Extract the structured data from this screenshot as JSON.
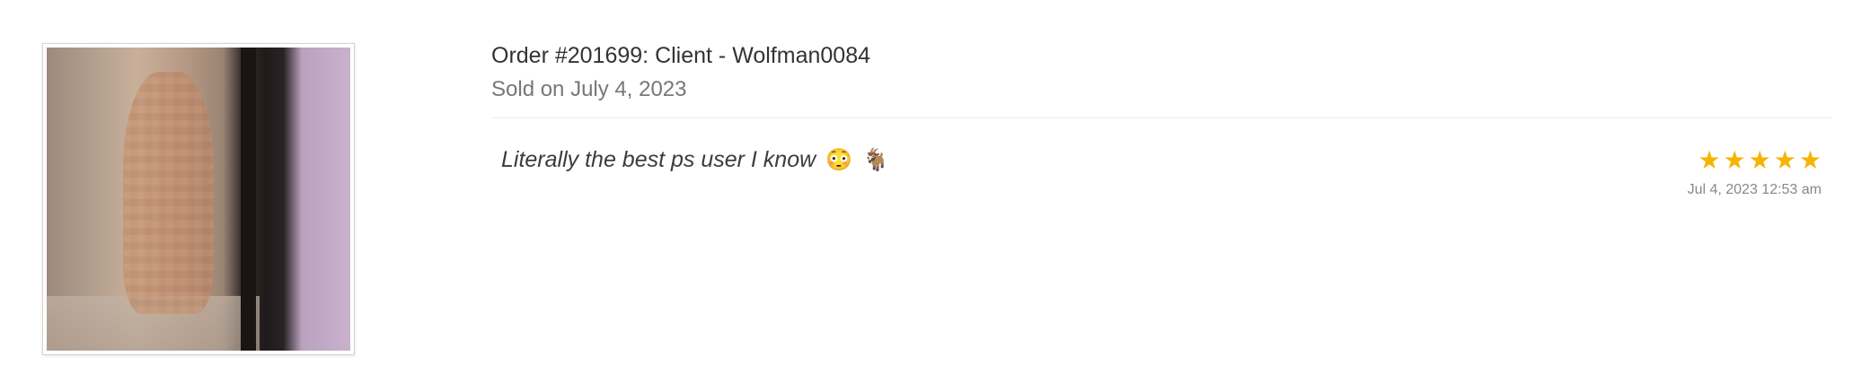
{
  "order": {
    "title": "Order #201699: Client - Wolfman0084",
    "sold_on": "Sold on July 4, 2023"
  },
  "review": {
    "text": "Literally the best ps user I know",
    "emojis": [
      "😳",
      "🐐"
    ],
    "rating": 5,
    "rating_max": 5,
    "date": "Jul 4, 2023 12:53 am",
    "star_color": "#f5b400"
  },
  "icons": {
    "star": "star-icon"
  }
}
